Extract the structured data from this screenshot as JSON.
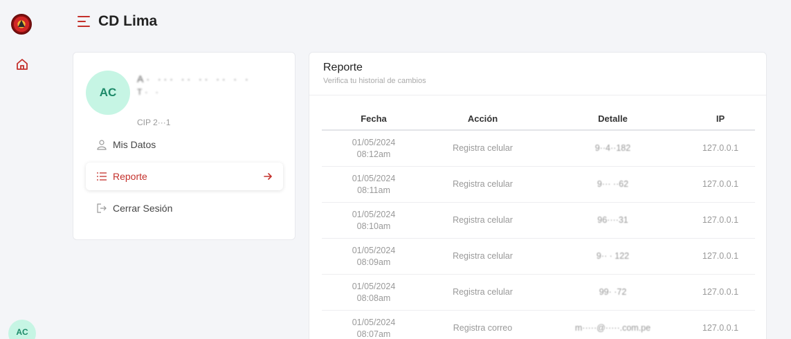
{
  "header": {
    "title": "CD Lima"
  },
  "rail": {
    "avatar_initials": "AC"
  },
  "profile": {
    "initials": "AC",
    "name_line1": "A· ··· ·· ·· ·· ·  ·",
    "name_line2": "T· ·",
    "cip": "CIP 2···1"
  },
  "nav": [
    {
      "label": "Mis Datos",
      "icon": "user-icon"
    },
    {
      "label": "Reporte",
      "icon": "list-icon",
      "active": true
    },
    {
      "label": "Cerrar Sesión",
      "icon": "logout-icon"
    }
  ],
  "report": {
    "title": "Reporte",
    "subtitle": "Verifica tu historial de cambios",
    "columns": [
      "Fecha",
      "Acción",
      "Detalle",
      "IP"
    ],
    "rows": [
      {
        "date": "01/05/2024",
        "time": "08:12am",
        "action": "Registra celular",
        "detail": "9··4··182",
        "ip": "127.0.0.1"
      },
      {
        "date": "01/05/2024",
        "time": "08:11am",
        "action": "Registra celular",
        "detail": "9··· ··62",
        "ip": "127.0.0.1"
      },
      {
        "date": "01/05/2024",
        "time": "08:10am",
        "action": "Registra celular",
        "detail": "96····31",
        "ip": "127.0.0.1"
      },
      {
        "date": "01/05/2024",
        "time": "08:09am",
        "action": "Registra celular",
        "detail": "9·· · 122",
        "ip": "127.0.0.1"
      },
      {
        "date": "01/05/2024",
        "time": "08:08am",
        "action": "Registra celular",
        "detail": "99·  ·72",
        "ip": "127.0.0.1"
      },
      {
        "date": "01/05/2024",
        "time": "08:07am",
        "action": "Registra correo",
        "detail": "m·····@·····.com.pe",
        "ip": "127.0.0.1"
      }
    ]
  },
  "colors": {
    "accent": "#c4302b",
    "avatar_bg": "#c6f5e4",
    "avatar_fg": "#1d8a69"
  }
}
